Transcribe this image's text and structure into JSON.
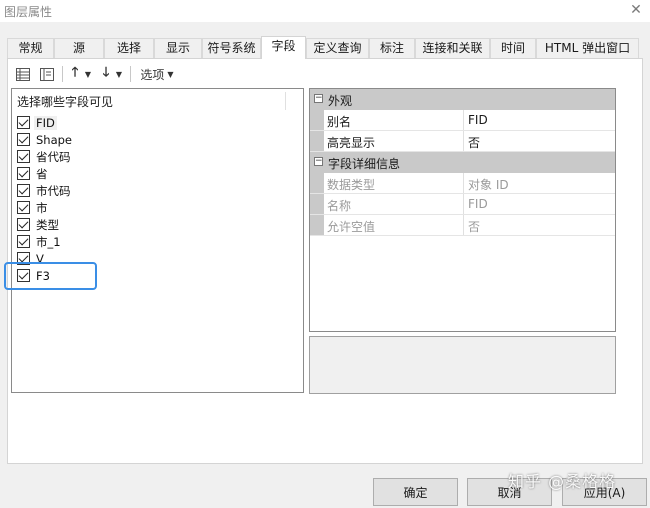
{
  "window": {
    "title": "图层属性",
    "close_icon": "close-icon"
  },
  "tabs": [
    {
      "label": "常规"
    },
    {
      "label": "源"
    },
    {
      "label": "选择"
    },
    {
      "label": "显示"
    },
    {
      "label": "符号系统"
    },
    {
      "label": "字段",
      "active": true
    },
    {
      "label": "定义查询"
    },
    {
      "label": "标注"
    },
    {
      "label": "连接和关联"
    },
    {
      "label": "时间"
    },
    {
      "label": "HTML 弹出窗口"
    }
  ],
  "toolbar": {
    "table_view_icon": "table-view-icon",
    "list_view_icon": "list-view-icon",
    "move_up_icon": "arrow-up-icon",
    "move_down_icon": "arrow-down-icon",
    "dropdown_icon": "chevron-down-icon",
    "options_label": "选项"
  },
  "field_list": {
    "header": "选择哪些字段可见",
    "items": [
      {
        "label": "FID",
        "checked": true,
        "selected": true
      },
      {
        "label": "Shape",
        "checked": true
      },
      {
        "label": "省代码",
        "checked": true
      },
      {
        "label": "省",
        "checked": true
      },
      {
        "label": "市代码",
        "checked": true
      },
      {
        "label": "市",
        "checked": true
      },
      {
        "label": "类型",
        "checked": true
      },
      {
        "label": "市_1",
        "checked": true
      },
      {
        "label": "V",
        "checked": true
      },
      {
        "label": "F3",
        "checked": true
      }
    ],
    "highlight_color": "#3a8ee6"
  },
  "properties": {
    "appearance": {
      "label": "外观",
      "toggle": "⊟",
      "rows": [
        {
          "name": "别名",
          "value": "FID"
        },
        {
          "name": "高亮显示",
          "value": "否"
        }
      ]
    },
    "details": {
      "label": "字段详细信息",
      "toggle": "⊟",
      "rows": [
        {
          "name": "数据类型",
          "value": "对象 ID"
        },
        {
          "name": "名称",
          "value": "FID"
        },
        {
          "name": "允许空值",
          "value": "否"
        }
      ]
    }
  },
  "buttons": {
    "ok": "确定",
    "cancel": "取消",
    "apply": "应用(A)"
  },
  "watermark": "知乎 @桑格格",
  "colors": {
    "dialog_bg": "#f0f0f0",
    "category_bg": "#c9c9c9",
    "dim_text": "#9a9a9a"
  }
}
